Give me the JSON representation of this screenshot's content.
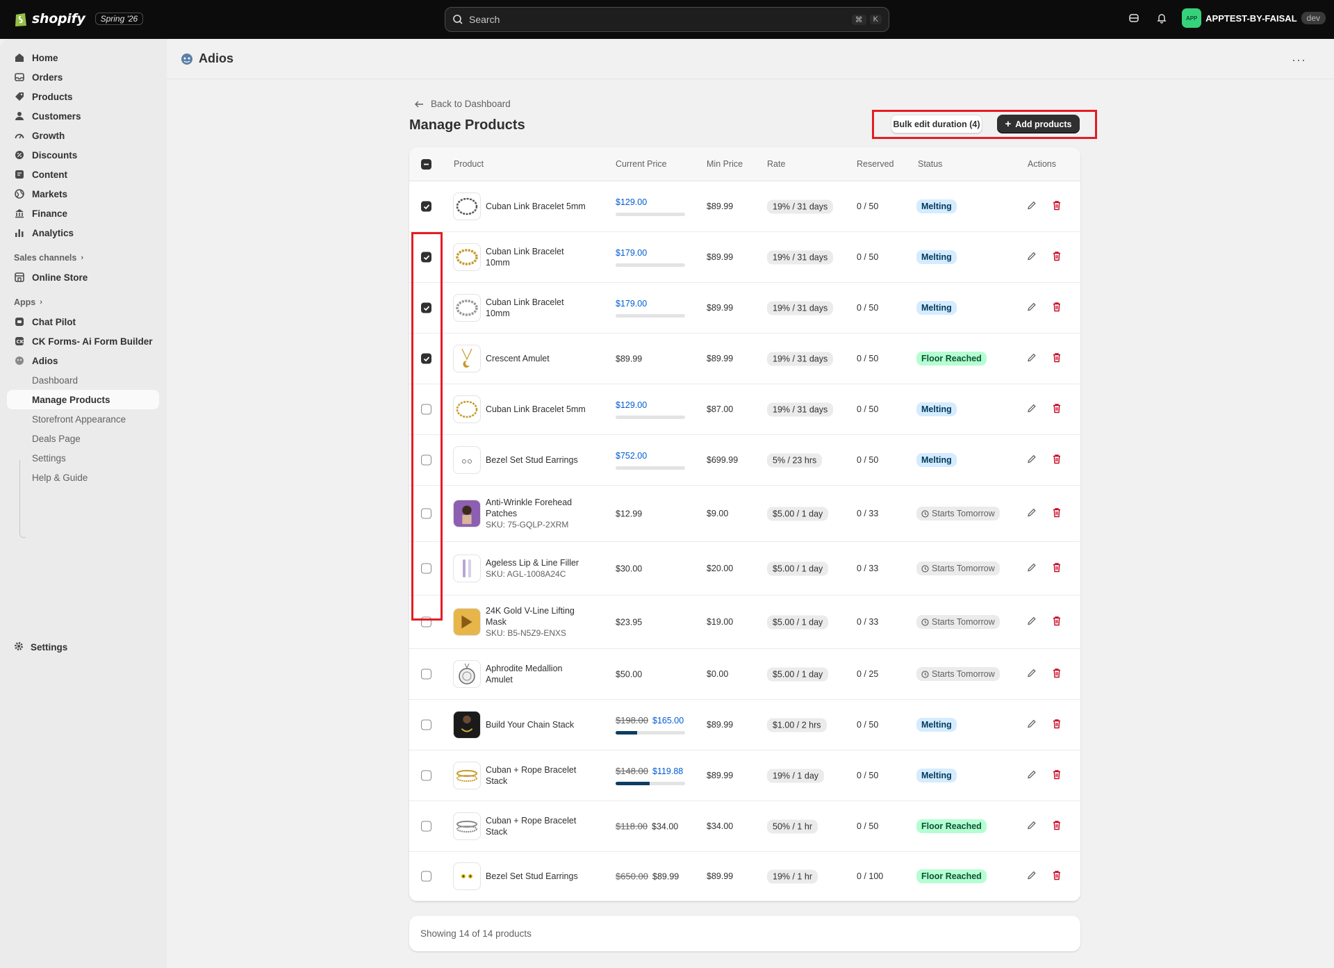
{
  "topbar": {
    "brand": "shopify",
    "version": "Spring '26",
    "search_placeholder": "Search",
    "shortcut_mod": "⌘",
    "shortcut_key": "K",
    "store_avatar": "APP",
    "store_name": "APPTEST-BY-FAISAL",
    "env_badge": "dev"
  },
  "sidebar": {
    "items": [
      {
        "label": "Home",
        "icon": "home-icon"
      },
      {
        "label": "Orders",
        "icon": "inbox-icon"
      },
      {
        "label": "Products",
        "icon": "tag-icon"
      },
      {
        "label": "Customers",
        "icon": "person-icon"
      },
      {
        "label": "Growth",
        "icon": "gauge-icon"
      },
      {
        "label": "Discounts",
        "icon": "discount-icon"
      },
      {
        "label": "Content",
        "icon": "content-icon"
      },
      {
        "label": "Markets",
        "icon": "globe-icon"
      },
      {
        "label": "Finance",
        "icon": "bank-icon"
      },
      {
        "label": "Analytics",
        "icon": "bar-chart-icon"
      }
    ],
    "sales_channels_label": "Sales channels",
    "online_store": "Online Store",
    "apps_label": "Apps",
    "apps": [
      "Chat Pilot",
      "CK Forms- Ai Form Builder",
      "Adios"
    ],
    "sub_items": [
      "Dashboard",
      "Manage Products",
      "Storefront Appearance",
      "Deals Page",
      "Settings",
      "Help & Guide"
    ],
    "settings": "Settings"
  },
  "page": {
    "app_title": "Adios",
    "more": "···",
    "back_link": "Back to Dashboard",
    "title": "Manage Products",
    "bulk_button": "Bulk edit duration (4)",
    "add_button": "Add products"
  },
  "table": {
    "headers": {
      "product": "Product",
      "price": "Current Price",
      "min": "Min Price",
      "rate": "Rate",
      "reserved": "Reserved",
      "status": "Status",
      "actions": "Actions"
    },
    "rows": [
      {
        "name": "Cuban Link Bracelet 5mm",
        "sku": "",
        "orig": "",
        "price": "$129.00",
        "progress": 0,
        "min": "$89.99",
        "rate": "19% / 31 days",
        "reserved": "0 / 50",
        "status": "Melting",
        "checked": true
      },
      {
        "name": "Cuban Link Bracelet 10mm",
        "sku": "",
        "orig": "",
        "price": "$179.00",
        "progress": 0,
        "min": "$89.99",
        "rate": "19% / 31 days",
        "reserved": "0 / 50",
        "status": "Melting",
        "checked": true
      },
      {
        "name": "Cuban Link Bracelet 10mm",
        "sku": "",
        "orig": "",
        "price": "$179.00",
        "progress": 0,
        "min": "$89.99",
        "rate": "19% / 31 days",
        "reserved": "0 / 50",
        "status": "Melting",
        "checked": true
      },
      {
        "name": "Crescent Amulet",
        "sku": "",
        "orig": "",
        "price": "$89.99",
        "progress": null,
        "min": "$89.99",
        "rate": "19% / 31 days",
        "reserved": "0 / 50",
        "status": "Floor Reached",
        "checked": true
      },
      {
        "name": "Cuban Link Bracelet 5mm",
        "sku": "",
        "orig": "",
        "price": "$129.00",
        "progress": 0,
        "min": "$87.00",
        "rate": "19% / 31 days",
        "reserved": "0 / 50",
        "status": "Melting",
        "checked": false
      },
      {
        "name": "Bezel Set Stud Earrings",
        "sku": "",
        "orig": "",
        "price": "$752.00",
        "progress": 0,
        "min": "$699.99",
        "rate": "5% / 23 hrs",
        "reserved": "0 / 50",
        "status": "Melting",
        "checked": false
      },
      {
        "name": "Anti-Wrinkle Forehead Patches",
        "sku": "SKU: 75-GQLP-2XRM",
        "orig": "",
        "price": "$12.99",
        "progress": null,
        "min": "$9.00",
        "rate": "$5.00 / 1 day",
        "reserved": "0 / 33",
        "status": "Starts Tomorrow",
        "checked": false
      },
      {
        "name": "Ageless Lip & Line Filler",
        "sku": "SKU: AGL-1008A24C",
        "orig": "",
        "price": "$30.00",
        "progress": null,
        "min": "$20.00",
        "rate": "$5.00 / 1 day",
        "reserved": "0 / 33",
        "status": "Starts Tomorrow",
        "checked": false
      },
      {
        "name": "24K Gold V-Line Lifting Mask",
        "sku": "SKU: B5-N5Z9-ENXS",
        "orig": "",
        "price": "$23.95",
        "progress": null,
        "min": "$19.00",
        "rate": "$5.00 / 1 day",
        "reserved": "0 / 33",
        "status": "Starts Tomorrow",
        "checked": false
      },
      {
        "name": "Aphrodite Medallion Amulet",
        "sku": "",
        "orig": "",
        "price": "$50.00",
        "progress": null,
        "min": "$0.00",
        "rate": "$5.00 / 1 day",
        "reserved": "0 / 25",
        "status": "Starts Tomorrow",
        "checked": false
      },
      {
        "name": "Build Your Chain Stack",
        "sku": "",
        "orig": "$198.00",
        "price": "$165.00",
        "progress": 0.31,
        "min": "$89.99",
        "rate": "$1.00 / 2 hrs",
        "reserved": "0 / 50",
        "status": "Melting",
        "checked": false
      },
      {
        "name": "Cuban + Rope Bracelet Stack",
        "sku": "",
        "orig": "$148.00",
        "price": "$119.88",
        "progress": 0.49,
        "min": "$89.99",
        "rate": "19% / 1 day",
        "reserved": "0 / 50",
        "status": "Melting",
        "checked": false
      },
      {
        "name": "Cuban + Rope Bracelet Stack",
        "sku": "",
        "orig": "$118.00",
        "price": "$34.00",
        "progress": null,
        "min": "$34.00",
        "rate": "50% / 1 hr",
        "reserved": "0 / 50",
        "status": "Floor Reached",
        "checked": false
      },
      {
        "name": "Bezel Set Stud Earrings",
        "sku": "",
        "orig": "$650.00",
        "price": "$89.99",
        "progress": null,
        "min": "$89.99",
        "rate": "19% / 1 hr",
        "reserved": "0 / 100",
        "status": "Floor Reached",
        "checked": false
      }
    ]
  },
  "footer": {
    "text": "Showing 14 of 14 products"
  },
  "colors": {
    "accent_dark": "#303030",
    "melting_bg": "#d5ebff",
    "floor_bg": "#b4fed2",
    "delete_red": "#c70a24",
    "annotation_red": "#e51c23",
    "price_blue": "#005bd3"
  }
}
